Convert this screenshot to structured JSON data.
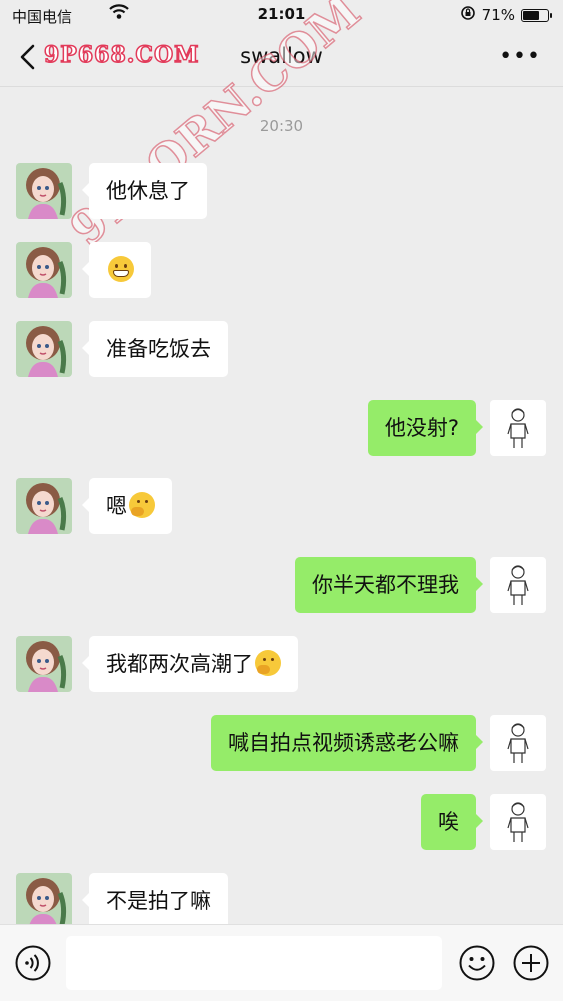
{
  "status_bar": {
    "carrier": "中国电信",
    "time": "21:01",
    "battery_percent": "71%",
    "battery_level": 0.71
  },
  "nav": {
    "title": "swallow"
  },
  "watermarks": [
    "9P668.COM",
    "91PORN.COM"
  ],
  "chat": {
    "timestamp": "20:30",
    "messages": [
      {
        "side": "in",
        "text": "他休息了"
      },
      {
        "side": "in",
        "text": "",
        "emoji": "grin-emoji"
      },
      {
        "side": "in",
        "text": "准备吃饭去"
      },
      {
        "side": "out",
        "text": "他没射?"
      },
      {
        "side": "in",
        "text": "嗯",
        "emoji": "think-emoji"
      },
      {
        "side": "out",
        "text": "你半天都不理我"
      },
      {
        "side": "in",
        "text": "我都两次高潮了",
        "emoji": "think-emoji"
      },
      {
        "side": "out",
        "text": "喊自拍点视频诱惑老公嘛"
      },
      {
        "side": "out",
        "text": "唉"
      },
      {
        "side": "in",
        "text": "不是拍了嘛"
      }
    ]
  },
  "input_bar": {
    "value": ""
  },
  "colors": {
    "background": "#ededed",
    "outgoing_bubble": "#95ec69",
    "incoming_bubble": "#ffffff"
  }
}
